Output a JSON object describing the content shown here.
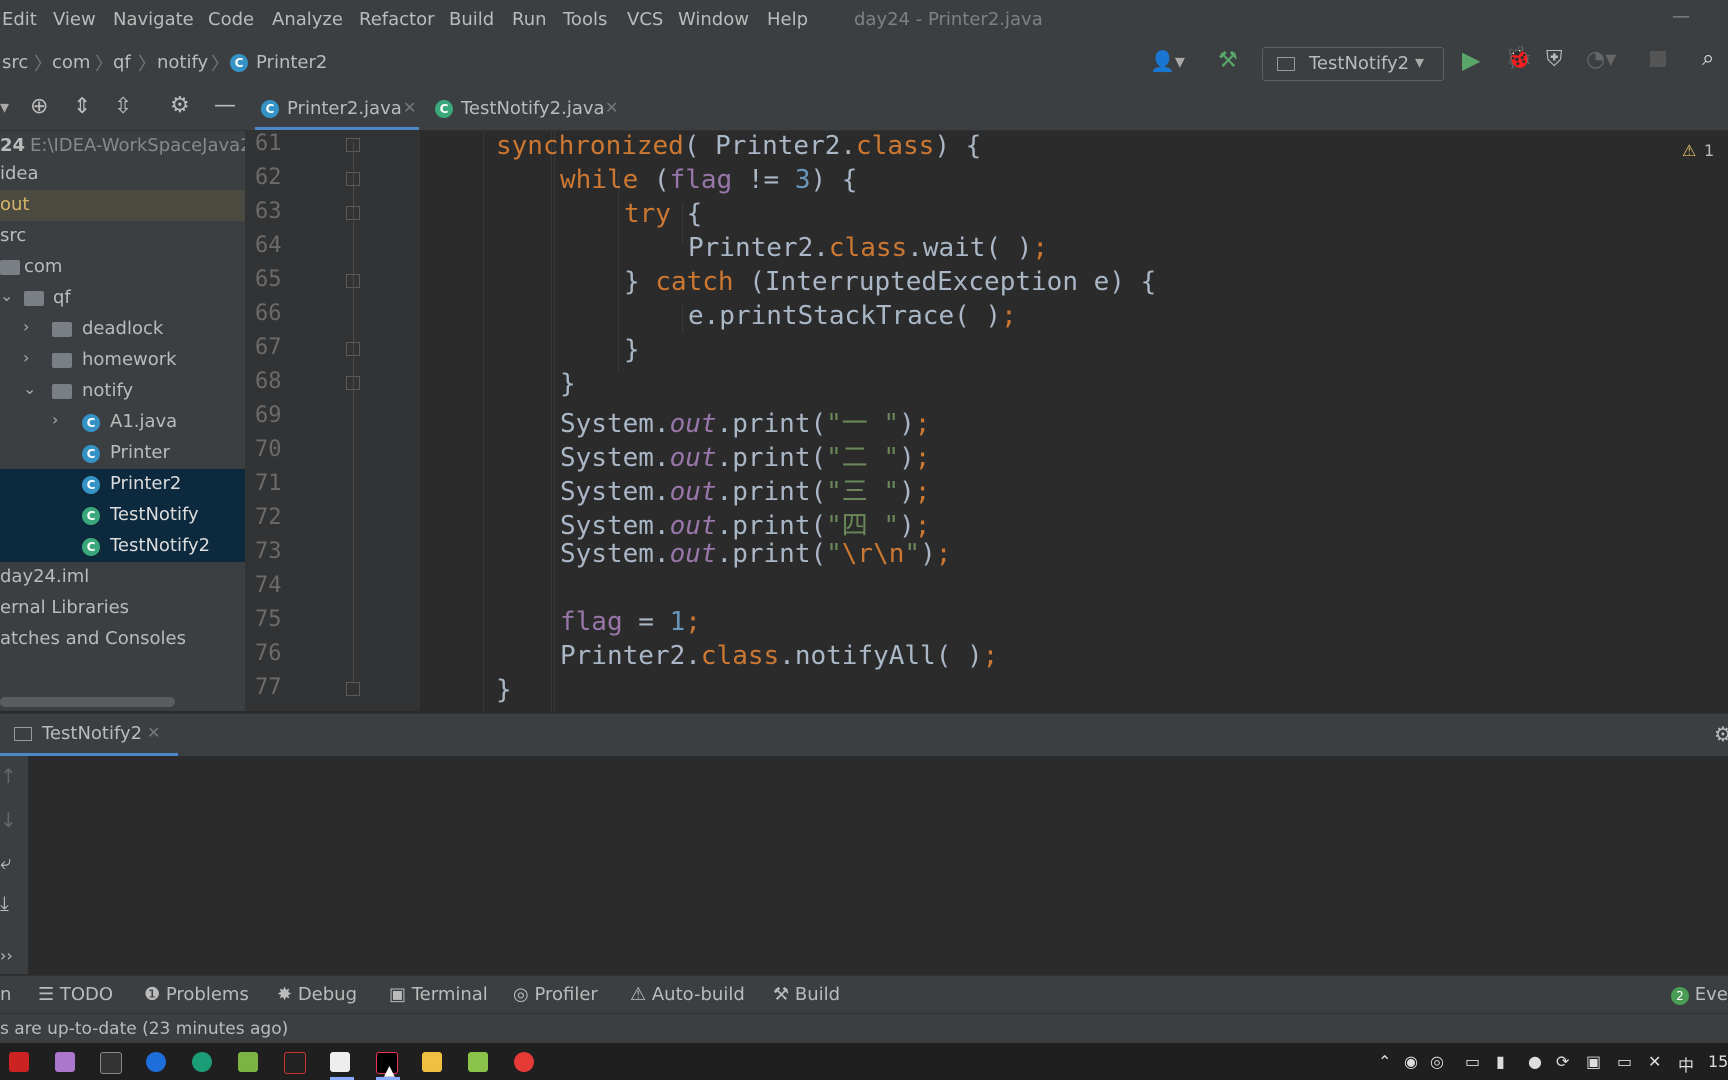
{
  "window": {
    "title": "day24 - Printer2.java"
  },
  "menu": [
    "Edit",
    "View",
    "Navigate",
    "Code",
    "Analyze",
    "Refactor",
    "Build",
    "Run",
    "Tools",
    "VCS",
    "Window",
    "Help"
  ],
  "breadcrumb": [
    "src",
    "com",
    "qf",
    "notify",
    "Printer2"
  ],
  "run_config": {
    "label": "TestNotify2"
  },
  "project": {
    "root_label": "24",
    "root_path": "E:\\IDEA-WorkSpaceJava2",
    "items": [
      {
        "label": "idea"
      },
      {
        "label": "out"
      },
      {
        "label": "src"
      },
      {
        "label": "com"
      },
      {
        "label": "qf"
      },
      {
        "label": "deadlock"
      },
      {
        "label": "homework"
      },
      {
        "label": "notify"
      },
      {
        "label": "A1.java"
      },
      {
        "label": "Printer"
      },
      {
        "label": "Printer2"
      },
      {
        "label": "TestNotify"
      },
      {
        "label": "TestNotify2"
      },
      {
        "label": "day24.iml"
      },
      {
        "label": "ernal Libraries"
      },
      {
        "label": "atches and Consoles"
      }
    ]
  },
  "editor": {
    "tabs": [
      {
        "label": "Printer2.java"
      },
      {
        "label": "TestNotify2.java"
      }
    ],
    "warning_count": "1",
    "line_numbers": [
      "61",
      "62",
      "63",
      "64",
      "65",
      "66",
      "67",
      "68",
      "69",
      "70",
      "71",
      "72",
      "73",
      "74",
      "75",
      "76",
      "77"
    ],
    "code": {
      "l61_a": "synchronized",
      "l61_b": "( Printer2.",
      "l61_c": "class",
      "l61_d": ") {",
      "l62_a": "while",
      "l62_b": " (",
      "l62_c": "flag",
      "l62_d": " != ",
      "l62_e": "3",
      "l62_f": ") {",
      "l63_a": "try",
      "l63_b": " {",
      "l64_a": "Printer2.",
      "l64_b": "class",
      "l64_c": ".wait( )",
      "l64_d": ";",
      "l65_a": "} ",
      "l65_b": "catch",
      "l65_c": " (InterruptedException e) {",
      "l66_a": "e.printStackTrace( )",
      "l66_b": ";",
      "l67_a": "}",
      "l68_a": "}",
      "l69_a": "System.",
      "l69_b": "out",
      "l69_c": ".print(",
      "l69_d": "\"一 \"",
      "l69_e": ")",
      "l69_f": ";",
      "l70_a": "System.",
      "l70_b": "out",
      "l70_c": ".print(",
      "l70_d": "\"二 \"",
      "l70_e": ")",
      "l70_f": ";",
      "l71_a": "System.",
      "l71_b": "out",
      "l71_c": ".print(",
      "l71_d": "\"三 \"",
      "l71_e": ")",
      "l71_f": ";",
      "l72_a": "System.",
      "l72_b": "out",
      "l72_c": ".print(",
      "l72_d": "\"四 \"",
      "l72_e": ")",
      "l72_f": ";",
      "l73_a": "System.",
      "l73_b": "out",
      "l73_c": ".print(",
      "l73_d": "\"",
      "l73_e": "\\r\\n",
      "l73_f": "\"",
      "l73_g": ")",
      "l73_h": ";",
      "l75_a": "flag",
      "l75_b": " = ",
      "l75_c": "1",
      "l75_d": ";",
      "l76_a": "Printer2.",
      "l76_b": "class",
      "l76_c": ".notifyAll( )",
      "l76_d": ";",
      "l77_a": "}"
    }
  },
  "run_window": {
    "tab_label": "TestNotify2"
  },
  "bottom_tools": [
    {
      "label": "n"
    },
    {
      "label": "TODO"
    },
    {
      "label": "Problems"
    },
    {
      "label": "Debug"
    },
    {
      "label": "Terminal"
    },
    {
      "label": "Profiler"
    },
    {
      "label": "Auto-build"
    },
    {
      "label": "Build"
    }
  ],
  "event_log": {
    "count": "2",
    "label": "Ever"
  },
  "status": {
    "message": "s are up-to-date (23 minutes ago)"
  },
  "taskbar": {
    "ime": "中",
    "clock": "15"
  },
  "colors": {
    "accent": "#4a88c7",
    "keyword": "#cc7832",
    "number": "#6897bb",
    "field": "#9876aa",
    "string": "#6a8759",
    "run_green": "#59a869"
  }
}
